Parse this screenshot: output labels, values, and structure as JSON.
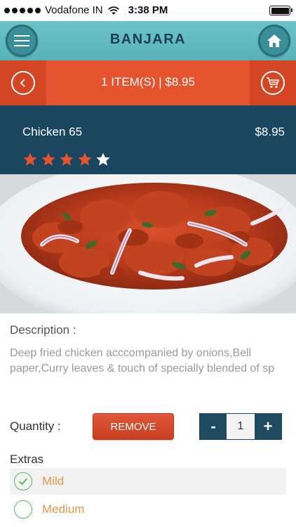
{
  "status_bar": {
    "carrier": "Vodafone IN",
    "time": "3:38 PM"
  },
  "header": {
    "title": "BANJARA",
    "menu_icon": "hamburger-menu-icon",
    "home_icon": "home-icon"
  },
  "cart_bar": {
    "summary": "1 ITEM(S) | $8.95",
    "back_icon": "chevron-left-icon",
    "cart_icon": "shopping-cart-icon"
  },
  "item": {
    "name": "Chicken 65",
    "price": "$8.95",
    "rating": 4,
    "rating_max": 5
  },
  "description": {
    "label": "Description :",
    "text": "Deep fried chicken acccompanied by onions,Bell paper,Curry leaves & touch of specially blended of sp"
  },
  "quantity": {
    "label": "Quantity :",
    "remove_label": "REMOVE",
    "minus_label": "-",
    "value": "1",
    "plus_label": "+"
  },
  "extras": {
    "label": "Extras",
    "options": [
      {
        "label": "Mild",
        "checked": true
      },
      {
        "label": "Medium",
        "checked": false
      }
    ]
  },
  "colors": {
    "header_teal": "#56b3b8",
    "cart_orange": "#e5532f",
    "info_navy": "#1a4660",
    "star_orange": "#e5532f",
    "extra_orange": "#e8954a",
    "check_green": "#5cb85c"
  }
}
